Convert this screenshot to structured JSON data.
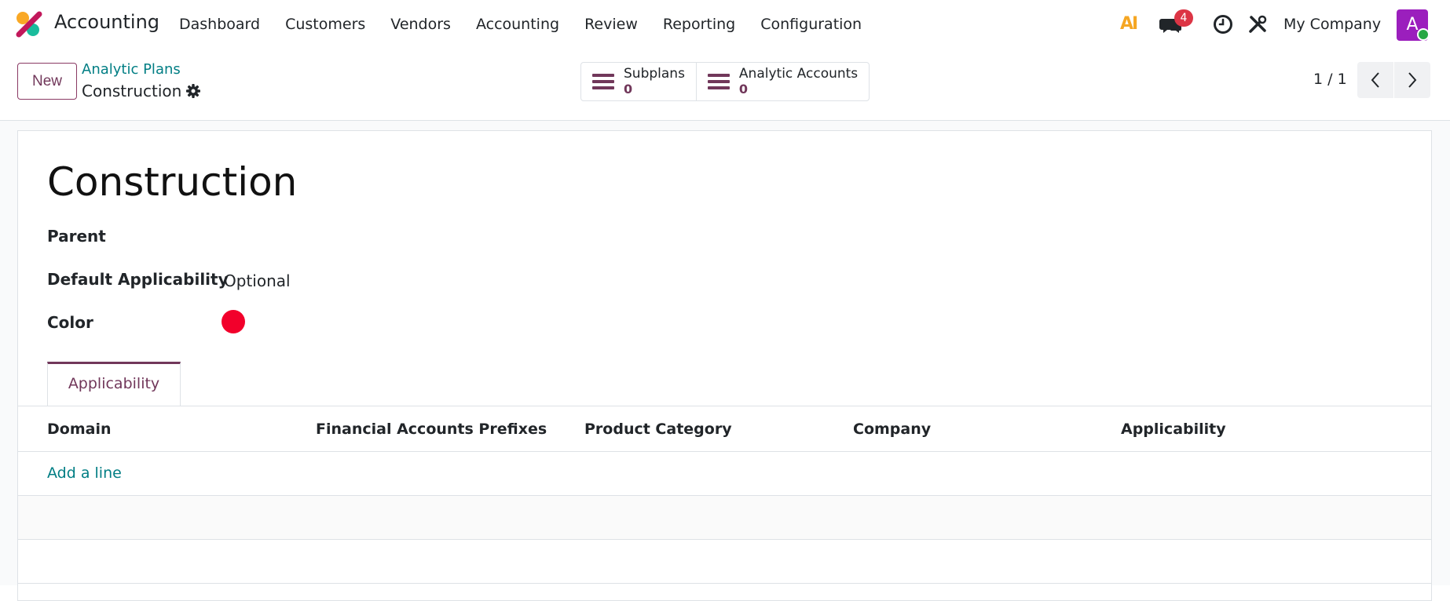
{
  "navbar": {
    "app_name": "Accounting",
    "menu": [
      "Dashboard",
      "Customers",
      "Vendors",
      "Accounting",
      "Review",
      "Reporting",
      "Configuration"
    ],
    "ai_label": "AI",
    "chat_count": "4",
    "company": "My Company",
    "avatar_initial": "A"
  },
  "control": {
    "new_label": "New",
    "breadcrumb_parent": "Analytic Plans",
    "breadcrumb_current": "Construction",
    "smart_buttons": [
      {
        "label": "Subplans",
        "count": "0"
      },
      {
        "label": "Analytic Accounts",
        "count": "0"
      }
    ],
    "pager": "1 / 1"
  },
  "form": {
    "title": "Construction",
    "fields": {
      "parent_label": "Parent",
      "applicability_label": "Default Applicability",
      "applicability_value": "Optional",
      "color_label": "Color"
    },
    "color": "#f2002b",
    "tab_label": "Applicability",
    "columns": [
      "Domain",
      "Financial Accounts Prefixes",
      "Product Category",
      "Company",
      "Applicability"
    ],
    "add_line": "Add a line"
  },
  "colors": {
    "brand": "#71375a",
    "link": "#017e84",
    "badge": "#dc3545",
    "avatar": "#9b1fbd"
  }
}
